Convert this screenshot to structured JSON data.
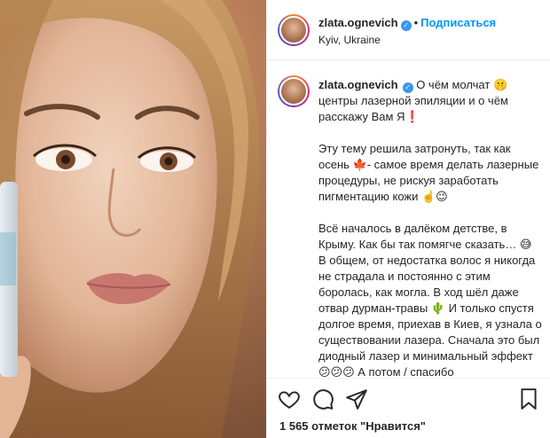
{
  "post": {
    "username": "zlata.ognevich",
    "follow_label": "Подписаться",
    "location": "Kyiv, Ukraine",
    "caption_first": "О чём молчат 🤫 центры лазерной эпиляции и о чём расскажу Вам Я❗",
    "paragraphs": [
      "Эту тему решила затронуть, так как осень 🍁- самое время делать лазерные процедуры, не рискуя заработать пигментацию кожи ☝️😉",
      "Всё началось в далёком детстве, в Крыму. Как бы так помягче сказать… 😅 В общем, от недостатка волос я никогда не страдала и постоянно с этим боролась, как могла. В ход шёл даже отвар дурман-травы 🌵 И только спустя долгое время, приехав в Киев, я узнала о существовании лазера. Сначала это был диодный лазер и минимальный эффект😕😕😕 А потом / спасибо"
    ],
    "likes_text": "1 565 отметок \"Нравится\""
  },
  "icons": {
    "verified": "verified-badge-icon",
    "more": "more-options-icon",
    "like": "heart-icon",
    "comment": "comment-icon",
    "share": "share-icon",
    "save": "bookmark-icon"
  },
  "colors": {
    "accent": "#0095f6",
    "verified": "#3897f0",
    "text": "#262626"
  }
}
